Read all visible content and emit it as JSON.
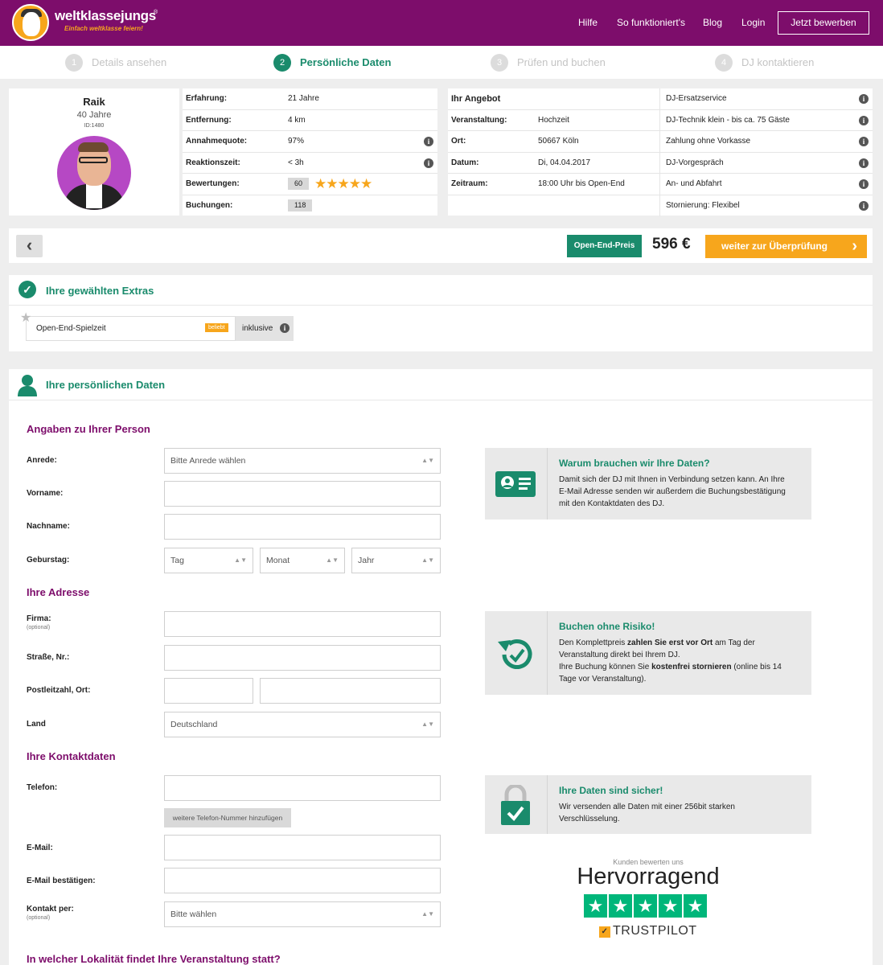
{
  "header": {
    "logo_text": "weltklassejungs",
    "logo_reg": "®",
    "logo_tagline": "Einfach weltklasse feiern!",
    "nav": [
      "Hilfe",
      "So funktioniert's",
      "Blog",
      "Login"
    ],
    "apply_button": "Jetzt bewerben",
    "colors": {
      "brand": "#7d0d6b",
      "accent": "#f7a61c",
      "green": "#1a8b6c"
    }
  },
  "steps": [
    {
      "num": "1",
      "label": "Details ansehen"
    },
    {
      "num": "2",
      "label": "Persönliche Daten"
    },
    {
      "num": "3",
      "label": "Prüfen und buchen"
    },
    {
      "num": "4",
      "label": "DJ kontaktieren"
    }
  ],
  "dj": {
    "name": "Raik",
    "age": "40 Jahre",
    "id": "ID:1480",
    "stats": [
      {
        "label": "Erfahrung:",
        "value": "21 Jahre",
        "info": false
      },
      {
        "label": "Entfernung:",
        "value": "4 km",
        "info": false
      },
      {
        "label": "Annahmequote:",
        "value": "97%",
        "info": true
      },
      {
        "label": "Reaktionszeit:",
        "value": "< 3h",
        "info": true
      },
      {
        "label": "Bewertungen:",
        "value": "60",
        "info": false
      },
      {
        "label": "Buchungen:",
        "value": "118",
        "info": false
      }
    ],
    "rating_stars": "★★★★★"
  },
  "offer": {
    "title": "Ihr Angebot",
    "rows": [
      {
        "label": "Veranstaltung:",
        "value": "Hochzeit"
      },
      {
        "label": "Ort:",
        "value": "50667 Köln"
      },
      {
        "label": "Datum:",
        "value": "Di, 04.04.2017"
      },
      {
        "label": "Zeitraum:",
        "value": "18:00 Uhr bis Open-End"
      }
    ],
    "services": [
      "DJ-Ersatzservice",
      "DJ-Technik klein - bis ca. 75 Gäste",
      "Zahlung ohne Vorkasse",
      "DJ-Vorgespräch",
      "An- und Abfahrt",
      "Stornierung: Flexibel"
    ]
  },
  "price_bar": {
    "back": "‹",
    "badge": "Open-End-Preis",
    "price": "596 €",
    "next": "weiter zur Überprüfung",
    "next_arrow": "›"
  },
  "extras": {
    "title": "Ihre gewählten Extras",
    "item": "Open-End-Spielzeit",
    "badge": "beliebt",
    "included": "inklusive"
  },
  "personal": {
    "title": "Ihre persönlichen Daten",
    "sec_person": "Angaben zu Ihrer Person",
    "sec_address": "Ihre Adresse",
    "sec_contact": "Ihre Kontaktdaten",
    "sec_location": "In welcher Lokalität findet Ihre Veranstaltung statt?",
    "labels": {
      "anrede": "Anrede:",
      "vorname": "Vorname:",
      "nachname": "Nachname:",
      "geburtstag": "Geburstag:",
      "firma": "Firma:",
      "optional": "(optional)",
      "strasse": "Straße, Nr.:",
      "plz": "Postleitzahl, Ort:",
      "land": "Land",
      "telefon": "Telefon:",
      "email": "E-Mail:",
      "email2": "E-Mail bestätigen:",
      "kontakt": "Kontakt per:"
    },
    "values": {
      "anrede": "Bitte Anrede wählen",
      "tag": "Tag",
      "monat": "Monat",
      "jahr": "Jahr",
      "land": "Deutschland",
      "kontakt": "Bitte wählen",
      "add_phone": "weitere Telefon-Nummer hinzufügen"
    }
  },
  "cards": [
    {
      "title": "Warum brauchen wir Ihre Daten?",
      "text": "Damit sich der DJ mit Ihnen in Verbindung setzen kann. An Ihre E-Mail Adresse senden wir außerdem die Buchungsbestätigung mit den Kontaktdaten des DJ."
    },
    {
      "title": "Buchen ohne Risiko!",
      "t1": "Den Komplettpreis ",
      "b1": "zahlen Sie erst vor Ort",
      "t2": " am Tag der Veranstaltung direkt bei Ihrem DJ.",
      "t3": "Ihre Buchung können Sie ",
      "b2": "kostenfrei stornieren",
      "t4": " (online bis 14 Tage vor Veranstaltung)."
    },
    {
      "title": "Ihre Daten sind sicher!",
      "text": "Wir versenden alle Daten mit einer 256bit starken Verschlüsselung."
    }
  ],
  "trustpilot": {
    "small": "Kunden bewerten uns",
    "big": "Hervorragend",
    "brand": "TRUSTPILOT",
    "rating": 5
  }
}
